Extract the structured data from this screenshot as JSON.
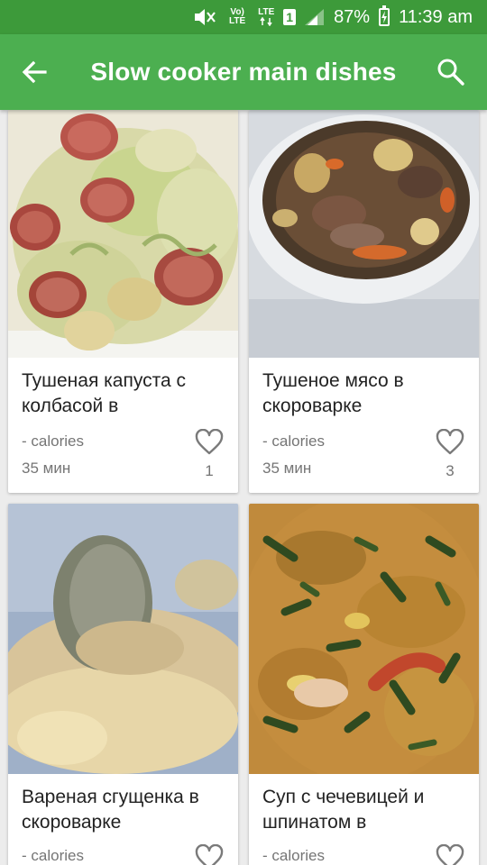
{
  "status": {
    "volte": "Vo) LTE",
    "lte": "LTE",
    "sim": "1",
    "battery": "87%",
    "time": "11:39 am"
  },
  "appbar": {
    "title": "Slow cooker main dishes",
    "back_icon": "arrow-left-icon",
    "search_icon": "search-icon"
  },
  "recipes": [
    {
      "name": "Тушеная капуста с колбасой в",
      "calories": "- calories",
      "time": "35 мин",
      "likes": "1"
    },
    {
      "name": "Тушеное мясо в скороварке",
      "calories": "- calories",
      "time": "35 мин",
      "likes": "3"
    },
    {
      "name": "Вареная сгущенка в скороварке",
      "calories": "- calories",
      "time": "",
      "likes": ""
    },
    {
      "name": "Суп с чечевицей и шпинатом в",
      "calories": "- calories",
      "time": "",
      "likes": ""
    }
  ],
  "colors": {
    "status_bar": "#3d9a3a",
    "app_bar": "#4caf50",
    "card": "#ffffff",
    "background": "#ececec"
  }
}
